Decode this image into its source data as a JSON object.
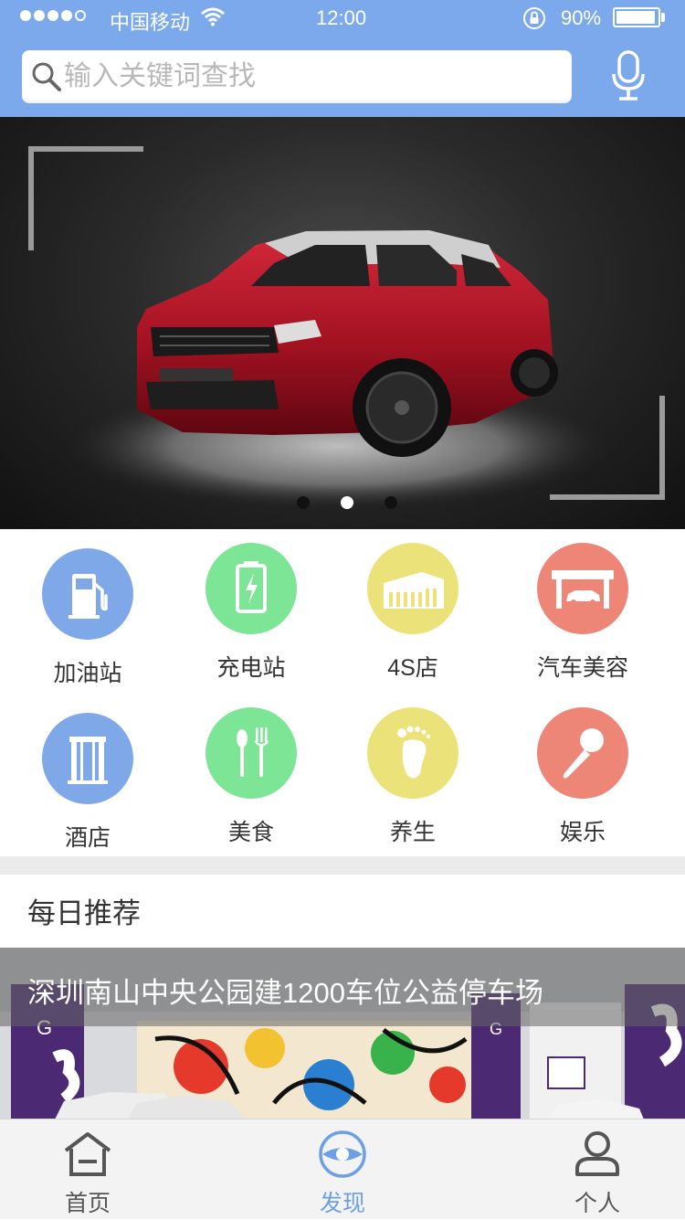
{
  "status_bar": {
    "carrier": "中国移动",
    "time": "12:00",
    "battery": "90%",
    "signal_bars": 4,
    "battery_level": 0.9
  },
  "search": {
    "placeholder": "输入关键词查找",
    "value": ""
  },
  "banner": {
    "slides": 3,
    "active_slide": 2,
    "image": "red-suv"
  },
  "categories": [
    {
      "label": "加油站",
      "icon": "gas-station-icon",
      "color": "#7fa8e8"
    },
    {
      "label": "充电站",
      "icon": "charging-station-icon",
      "color": "#7de596"
    },
    {
      "label": "4S店",
      "icon": "dealership-icon",
      "color": "#ece27a"
    },
    {
      "label": "汽车美容",
      "icon": "car-wash-icon",
      "color": "#ee8678"
    },
    {
      "label": "酒店",
      "icon": "hotel-icon",
      "color": "#7fa8e8"
    },
    {
      "label": "美食",
      "icon": "food-icon",
      "color": "#7de596"
    },
    {
      "label": "养生",
      "icon": "foot-massage-icon",
      "color": "#ece27a"
    },
    {
      "label": "娱乐",
      "icon": "microphone-icon",
      "color": "#ee8678"
    }
  ],
  "daily": {
    "title": "每日推荐",
    "article_title": "深圳南山中央公园建1200车位公益停车场"
  },
  "tabs": [
    {
      "label": "首页",
      "icon": "home-icon",
      "active": false
    },
    {
      "label": "发现",
      "icon": "discover-eye-icon",
      "active": true
    },
    {
      "label": "个人",
      "icon": "user-icon",
      "active": false
    }
  ],
  "colors": {
    "header": "#7ba9eb",
    "tab_active": "#6c9fe6",
    "tab_inactive": "#555555"
  }
}
